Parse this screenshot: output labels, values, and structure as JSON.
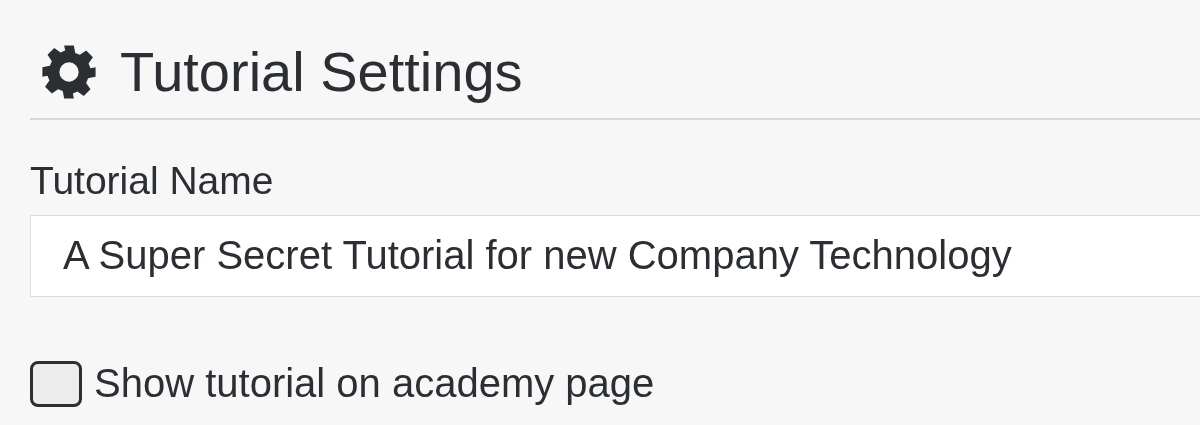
{
  "heading": {
    "title": "Tutorial Settings"
  },
  "name_field": {
    "label": "Tutorial Name",
    "value": "A Super Secret Tutorial for new Company Technology"
  },
  "show_on_academy": {
    "label": "Show tutorial on academy page",
    "checked": false
  }
}
